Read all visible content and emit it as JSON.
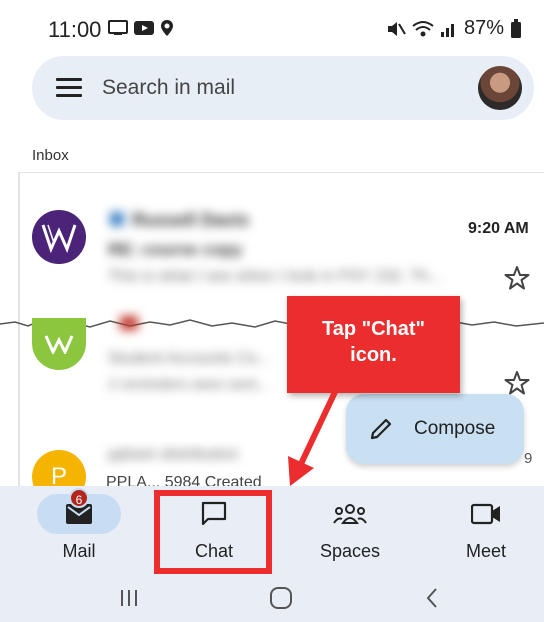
{
  "status_bar": {
    "time": "11:00",
    "battery": "87%"
  },
  "search": {
    "placeholder": "Search in mail"
  },
  "inbox_label": "Inbox",
  "emails": [
    {
      "sender": "Russell Davis",
      "subject": "RE: course copy",
      "snippet": "This is what I see when I look in PSY 232. Th...",
      "time": "9:20 AM",
      "avatar_color": "#4b2378"
    },
    {
      "sender": "Student Accounts Ce...",
      "subject": "",
      "snippet": "2 reminders were sent...",
      "time": "",
      "avatar_color": "#8cc63f"
    },
    {
      "sender": "ppbam distribution",
      "subject": "",
      "snippet": "PPLA... 5984 Created",
      "time": "9",
      "avatar_color": "#f5b400",
      "avatar_letter": "P"
    }
  ],
  "callout": {
    "line1": "Tap \"Chat\"",
    "line2": "icon."
  },
  "compose": {
    "label": "Compose"
  },
  "nav": {
    "mail": {
      "label": "Mail",
      "badge": "6"
    },
    "chat": {
      "label": "Chat"
    },
    "spaces": {
      "label": "Spaces"
    },
    "meet": {
      "label": "Meet"
    }
  },
  "colors": {
    "accent_red": "#ec2d2d",
    "nav_bg": "#e9eef6",
    "compose_bg": "#c9e0f2",
    "badge_red": "#b3261e"
  }
}
